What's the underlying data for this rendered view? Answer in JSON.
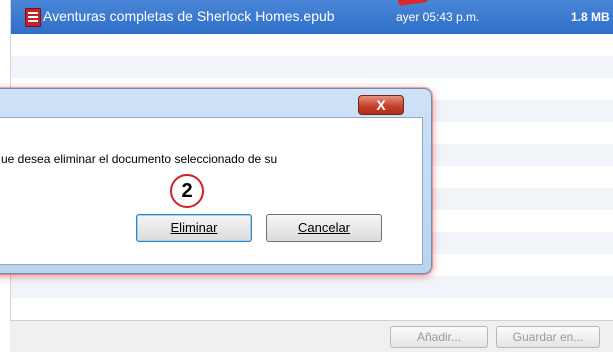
{
  "file_list": {
    "selected_file": {
      "name": "Aventuras completas de Sherlock Homes.epub",
      "modified": "ayer 05:43 p.m.",
      "size": "1.8 MB"
    }
  },
  "dialog": {
    "close_label": "X",
    "message": "ue desea eliminar el documento seleccionado de su",
    "step_badge": "2",
    "confirm_label": "Eliminar",
    "cancel_label": "Cancelar"
  },
  "bottom_bar": {
    "add_label": "Añadir...",
    "save_label": "Guardar en..."
  },
  "colors": {
    "selection": "#2f6fc8",
    "annotation_red": "#d42020",
    "dialog_frame": "#b9d3ef"
  }
}
